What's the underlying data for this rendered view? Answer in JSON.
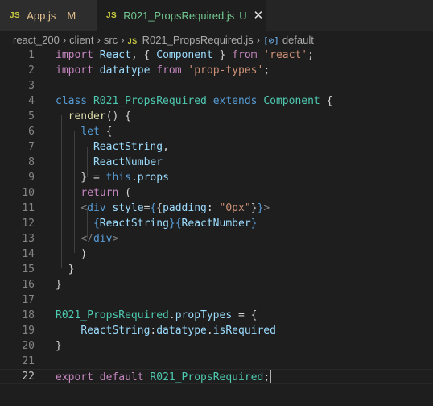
{
  "tabs": [
    {
      "icon": "JS",
      "label": "App.js",
      "status": "M"
    },
    {
      "icon": "JS",
      "label": "R021_PropsRequired.js",
      "status": "U"
    }
  ],
  "breadcrumb": {
    "items": [
      "react_200",
      "client",
      "src",
      "R021_PropsRequired.js",
      "default"
    ],
    "file_icon": "JS"
  },
  "editor": {
    "current_line": 22,
    "lines": [
      {
        "n": "1",
        "tokens": [
          [
            "import",
            "c"
          ],
          [
            " ",
            "p"
          ],
          [
            "React",
            "v"
          ],
          [
            ", { ",
            "p"
          ],
          [
            "Component",
            "v"
          ],
          [
            " } ",
            "p"
          ],
          [
            "from",
            "c"
          ],
          [
            " ",
            "p"
          ],
          [
            "'react'",
            "s"
          ],
          [
            ";",
            "p"
          ]
        ]
      },
      {
        "n": "2",
        "tokens": [
          [
            "import",
            "c"
          ],
          [
            " ",
            "p"
          ],
          [
            "datatype",
            "v"
          ],
          [
            " ",
            "p"
          ],
          [
            "from",
            "c"
          ],
          [
            " ",
            "p"
          ],
          [
            "'prop-types'",
            "s"
          ],
          [
            ";",
            "p"
          ]
        ]
      },
      {
        "n": "3",
        "tokens": []
      },
      {
        "n": "4",
        "tokens": [
          [
            "class",
            "k"
          ],
          [
            " ",
            "p"
          ],
          [
            "R021_PropsRequired",
            "t"
          ],
          [
            " ",
            "p"
          ],
          [
            "extends",
            "k"
          ],
          [
            " ",
            "p"
          ],
          [
            "Component",
            "t"
          ],
          [
            " {",
            "p"
          ]
        ]
      },
      {
        "n": "5",
        "tokens": [
          [
            "  ",
            "p"
          ],
          [
            "render",
            "f"
          ],
          [
            "() {",
            "p"
          ]
        ]
      },
      {
        "n": "6",
        "tokens": [
          [
            "    ",
            "p"
          ],
          [
            "let",
            "k"
          ],
          [
            " {",
            "p"
          ]
        ]
      },
      {
        "n": "7",
        "tokens": [
          [
            "      ",
            "p"
          ],
          [
            "ReactString",
            "v"
          ],
          [
            ",",
            "p"
          ]
        ]
      },
      {
        "n": "8",
        "tokens": [
          [
            "      ",
            "p"
          ],
          [
            "ReactNumber",
            "v"
          ]
        ]
      },
      {
        "n": "9",
        "tokens": [
          [
            "    } = ",
            "p"
          ],
          [
            "this",
            "k"
          ],
          [
            ".",
            "p"
          ],
          [
            "props",
            "v"
          ]
        ]
      },
      {
        "n": "10",
        "tokens": [
          [
            "    ",
            "p"
          ],
          [
            "return",
            "c"
          ],
          [
            " (",
            "p"
          ]
        ]
      },
      {
        "n": "11",
        "tokens": [
          [
            "    ",
            "p"
          ],
          [
            "<",
            "g"
          ],
          [
            "div",
            "k"
          ],
          [
            " ",
            "p"
          ],
          [
            "style",
            "v"
          ],
          [
            "=",
            "p"
          ],
          [
            "{",
            "k"
          ],
          [
            "{",
            "p"
          ],
          [
            "padding",
            "v"
          ],
          [
            ": ",
            "p"
          ],
          [
            "\"0px\"",
            "s"
          ],
          [
            "}",
            "p"
          ],
          [
            "}",
            "k"
          ],
          [
            ">",
            "g"
          ]
        ]
      },
      {
        "n": "12",
        "tokens": [
          [
            "      ",
            "p"
          ],
          [
            "{",
            "k"
          ],
          [
            "ReactString",
            "v"
          ],
          [
            "}",
            "k"
          ],
          [
            "{",
            "k"
          ],
          [
            "ReactNumber",
            "v"
          ],
          [
            "}",
            "k"
          ]
        ]
      },
      {
        "n": "13",
        "tokens": [
          [
            "    ",
            "p"
          ],
          [
            "</",
            "g"
          ],
          [
            "div",
            "k"
          ],
          [
            ">",
            "g"
          ]
        ]
      },
      {
        "n": "14",
        "tokens": [
          [
            "    )",
            "p"
          ]
        ]
      },
      {
        "n": "15",
        "tokens": [
          [
            "  }",
            "p"
          ]
        ]
      },
      {
        "n": "16",
        "tokens": [
          [
            "}",
            "p"
          ]
        ]
      },
      {
        "n": "17",
        "tokens": []
      },
      {
        "n": "18",
        "tokens": [
          [
            "R021_PropsRequired",
            "t"
          ],
          [
            ".",
            "p"
          ],
          [
            "propTypes",
            "v"
          ],
          [
            " = {",
            "p"
          ]
        ]
      },
      {
        "n": "19",
        "tokens": [
          [
            "    ",
            "p"
          ],
          [
            "ReactString",
            "v"
          ],
          [
            ":",
            "p"
          ],
          [
            "datatype",
            "v"
          ],
          [
            ".",
            "p"
          ],
          [
            "isRequired",
            "v"
          ]
        ]
      },
      {
        "n": "20",
        "tokens": [
          [
            "}",
            "p"
          ]
        ]
      },
      {
        "n": "21",
        "tokens": []
      },
      {
        "n": "22",
        "tokens": [
          [
            "export",
            "c"
          ],
          [
            " ",
            "p"
          ],
          [
            "default",
            "c"
          ],
          [
            " ",
            "p"
          ],
          [
            "R021_PropsRequired",
            "t"
          ],
          [
            ";",
            "p"
          ]
        ]
      }
    ]
  }
}
